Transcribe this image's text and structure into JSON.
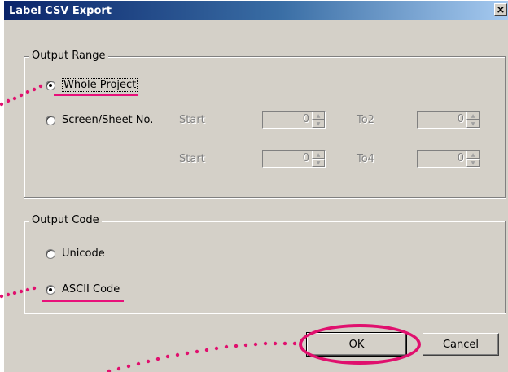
{
  "window": {
    "title": "Label CSV Export"
  },
  "output_range": {
    "legend": "Output Range",
    "options": [
      {
        "label": "Whole Project",
        "checked": true
      },
      {
        "label": "Screen/Sheet No.",
        "checked": false
      }
    ],
    "rows": [
      {
        "start_label": "Start",
        "start_value": "0",
        "to_label": "To2",
        "to_value": "0"
      },
      {
        "start_label": "Start",
        "start_value": "0",
        "to_label": "To4",
        "to_value": "0"
      }
    ]
  },
  "output_code": {
    "legend": "Output Code",
    "options": [
      {
        "label": "Unicode",
        "checked": false
      },
      {
        "label": "ASCII Code",
        "checked": true
      }
    ]
  },
  "buttons": {
    "ok": "OK",
    "cancel": "Cancel"
  },
  "close_glyph": "×",
  "accent_color": "#e0106e"
}
